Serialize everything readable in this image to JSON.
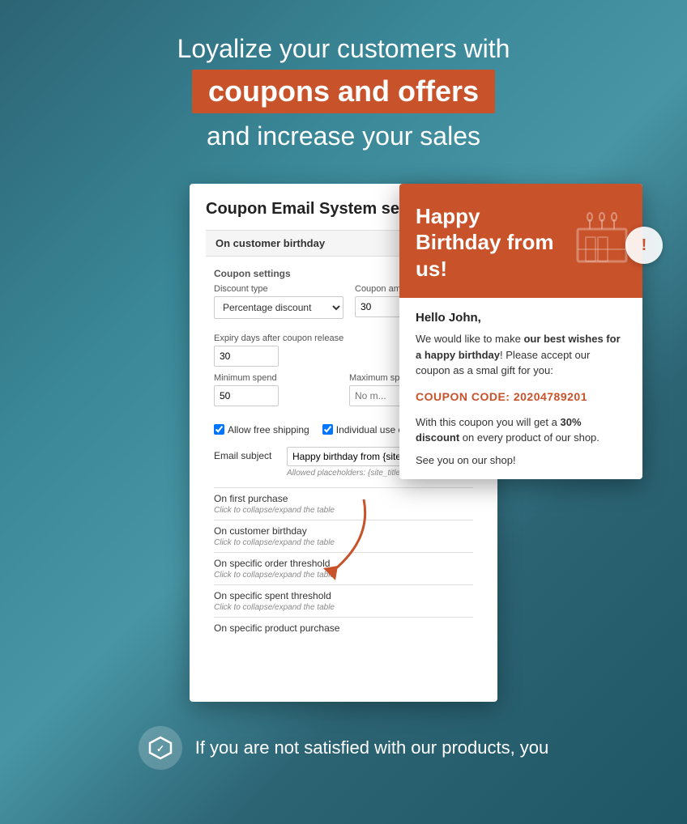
{
  "header": {
    "line1": "Loyalize your customers with",
    "highlight": "coupons and offers",
    "line3": "and increase your sales"
  },
  "settings": {
    "title": "Coupon Email System settings",
    "section_birthday": "On customer birthday",
    "coupon_settings_label": "Coupon settings",
    "discount_type_label": "Discount type",
    "discount_type_value": "Percentage discount",
    "coupon_amount_label": "Coupon amount",
    "coupon_amount_value": "30",
    "expiry_days_label": "Expiry days after coupon release",
    "expiry_days_value": "30",
    "minimum_spend_label": "Minimum spend",
    "minimum_spend_value": "50",
    "maximum_spend_label": "Maximum spend",
    "maximum_spend_placeholder": "No m...",
    "allow_free_shipping_label": "Allow free shipping",
    "individual_use_label": "Individual use o...",
    "email_subject_label": "Email subject",
    "email_subject_value": "Happy birthday from {site_title...",
    "allowed_placeholders": "Allowed placeholders: {site_title...",
    "rows": [
      {
        "title": "On first purchase",
        "sub": "Click to collapse/expand the table"
      },
      {
        "title": "On customer birthday",
        "sub": "Click to collapse/expand the table"
      },
      {
        "title": "On specific order threshold",
        "sub": "Click to collapse/expand the table"
      },
      {
        "title": "On specific spent threshold",
        "sub": "Click to collapse/expand the table"
      },
      {
        "title": "On specific product purchase",
        "sub": ""
      }
    ]
  },
  "email_card": {
    "header_title": "Happy Birthday from us!",
    "greeting": "Hello John,",
    "body_intro": "We would like to make ",
    "body_bold": "our best wishes for a happy birthday",
    "body_mid": "! Please accept our coupon as a smal gift for you:",
    "coupon_label": "COUPON CODE:",
    "coupon_code": "20204789201",
    "discount_text_pre": "With this coupon you will get a ",
    "discount_bold": "30% discount",
    "discount_text_post": " on every product of our shop.",
    "sign_off": "See you on our shop!"
  },
  "bottom": {
    "text": "If you are not satisfied with our products, you"
  },
  "icons": {
    "notification": "!",
    "cake": "🎂",
    "arrow": "↩",
    "bottom_icon": "⬡"
  }
}
